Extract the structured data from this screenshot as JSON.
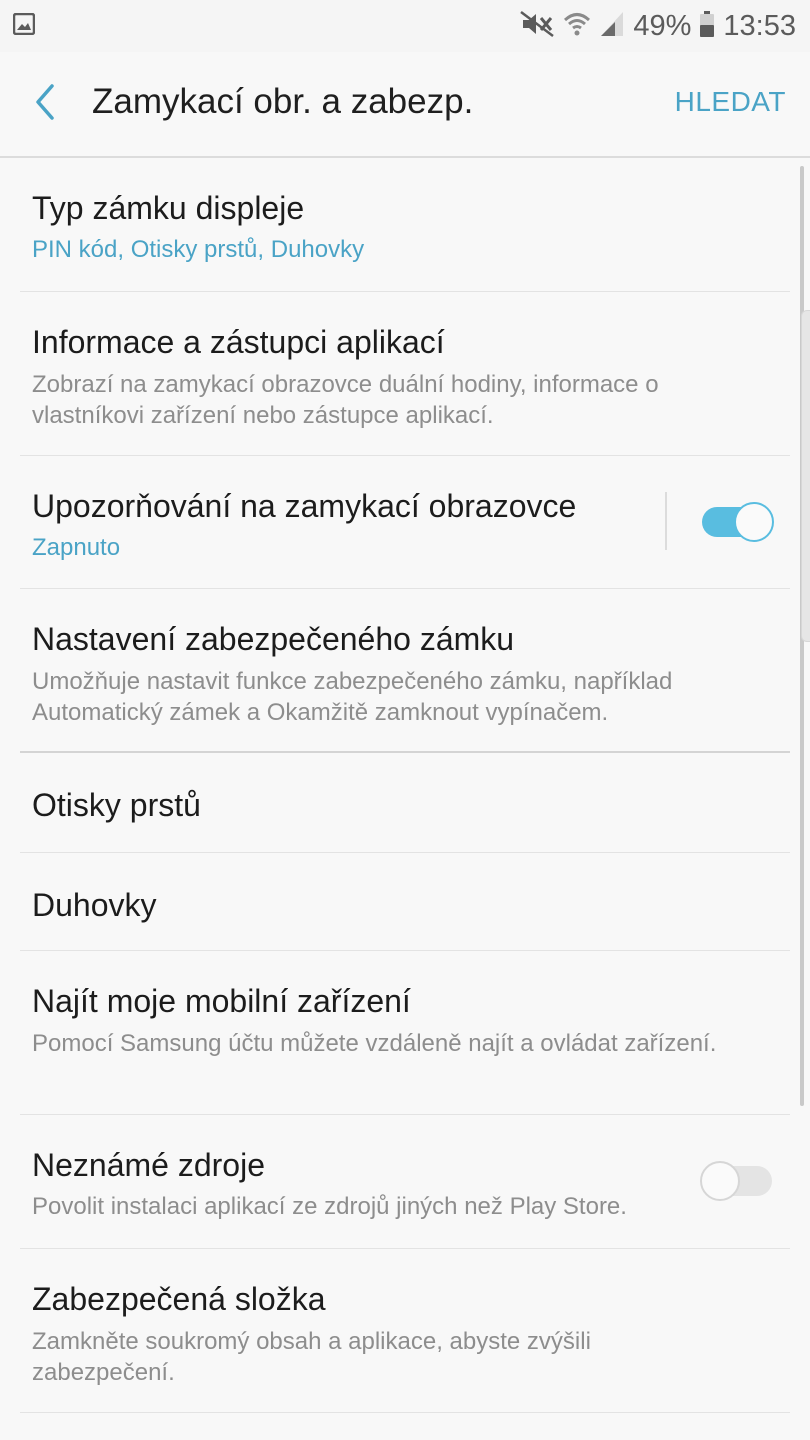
{
  "status_bar": {
    "battery_percent": "49%",
    "time": "13:53",
    "icons": [
      "gallery-icon",
      "mute-icon",
      "wifi-icon",
      "signal-icon",
      "battery-icon"
    ]
  },
  "app_bar": {
    "back_icon": "chevron-left-icon",
    "title": "Zamykací obr. a zabezp.",
    "search_label": "HLEDAT"
  },
  "colors": {
    "accent": "#4aa3c6",
    "switch_on": "#59bde0",
    "background": "#f8f8f8"
  },
  "settings": [
    {
      "title": "Typ zámku displeje",
      "subtitle": "PIN kód, Otisky prstů, Duhovky",
      "subtitle_accent": true
    },
    {
      "title": "Informace a zástupci aplikací",
      "subtitle": "Zobrazí na zamykací obrazovce duální hodiny, informace o vlastníkovi zařízení nebo zástupce aplikací."
    },
    {
      "title": "Upozorňování na zamykací obrazovce",
      "subtitle": "Zapnuto",
      "subtitle_accent": true,
      "switch": "on"
    },
    {
      "title": "Nastavení zabezpečeného zámku",
      "subtitle": "Umožňuje nastavit funkce zabezpečeného zámku, například Automatický zámek a Okamžitě zamknout vypínačem."
    },
    {
      "title": "Otisky prstů"
    },
    {
      "title": "Duhovky"
    },
    {
      "title": "Najít moje mobilní zařízení",
      "subtitle": "Pomocí Samsung účtu můžete vzdáleně najít a ovládat zařízení."
    },
    {
      "title": "Neznámé zdroje",
      "subtitle": "Povolit instalaci aplikací ze zdrojů jiných než Play Store.",
      "switch": "off"
    },
    {
      "title": "Zabezpečená složka",
      "subtitle": "Zamkněte soukromý obsah a aplikace, abyste zvýšili zabezpečení."
    }
  ]
}
